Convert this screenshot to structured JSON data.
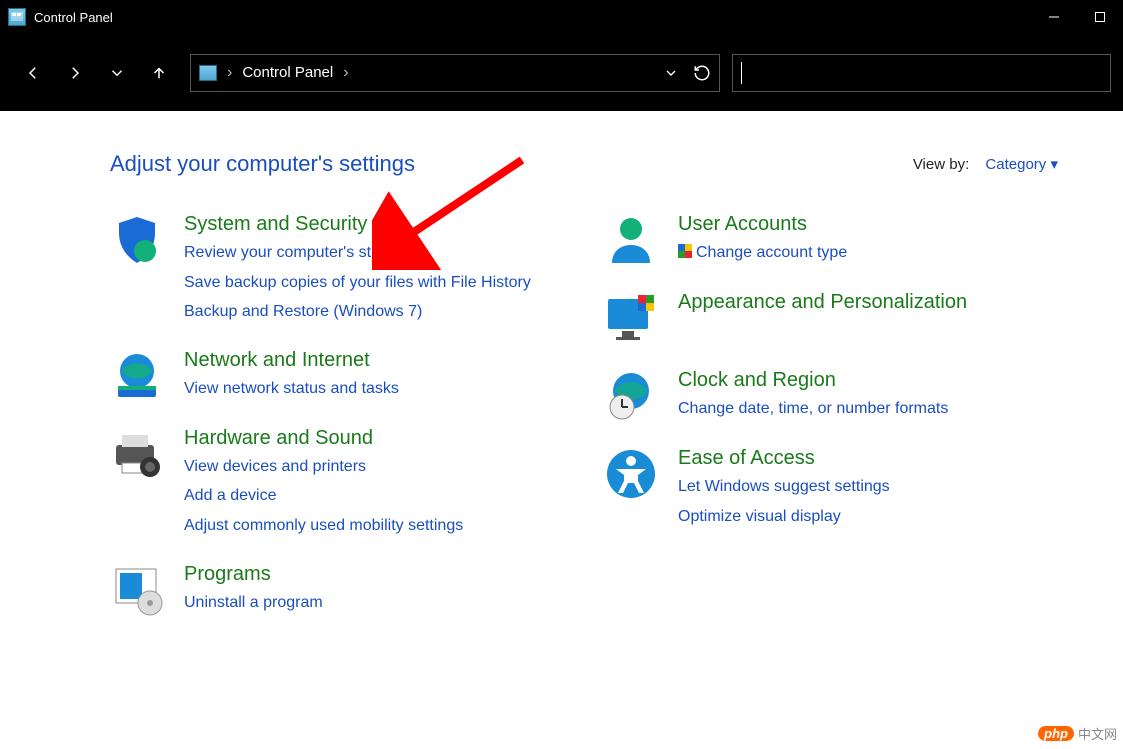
{
  "window": {
    "title": "Control Panel"
  },
  "breadcrumb": {
    "root": "Control Panel"
  },
  "header": {
    "title": "Adjust your computer's settings",
    "viewby_label": "View by:",
    "viewby_value": "Category"
  },
  "categories": {
    "system_security": {
      "title": "System and Security",
      "links": [
        "Review your computer's status",
        "Save backup copies of your files with File History",
        "Backup and Restore (Windows 7)"
      ]
    },
    "network": {
      "title": "Network and Internet",
      "links": [
        "View network status and tasks"
      ]
    },
    "hardware": {
      "title": "Hardware and Sound",
      "links": [
        "View devices and printers",
        "Add a device",
        "Adjust commonly used mobility settings"
      ]
    },
    "programs": {
      "title": "Programs",
      "links": [
        "Uninstall a program"
      ]
    },
    "users": {
      "title": "User Accounts",
      "links": [
        "Change account type"
      ]
    },
    "appearance": {
      "title": "Appearance and Personalization",
      "links": []
    },
    "clock": {
      "title": "Clock and Region",
      "links": [
        "Change date, time, or number formats"
      ]
    },
    "ease": {
      "title": "Ease of Access",
      "links": [
        "Let Windows suggest settings",
        "Optimize visual display"
      ]
    }
  },
  "watermark": {
    "brand": "php",
    "text": "中文网"
  }
}
